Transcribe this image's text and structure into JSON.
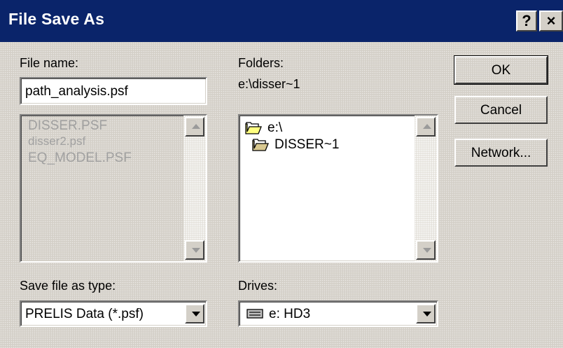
{
  "window": {
    "title": "File Save As",
    "help_label": "?",
    "close_label": "×"
  },
  "file_name": {
    "label": "File name:",
    "value": "path_analysis.psf"
  },
  "file_list": {
    "items": [
      "DISSER.PSF",
      "disser2.psf",
      "EQ_MODEL.PSF"
    ]
  },
  "folders": {
    "label": "Folders:",
    "current_path": "e:\\disser~1",
    "items": [
      "e:\\",
      "DISSER~1"
    ]
  },
  "buttons": {
    "ok": "OK",
    "cancel": "Cancel",
    "network": "Network..."
  },
  "save_type": {
    "label": "Save file as type:",
    "value": "PRELIS Data (*.psf)"
  },
  "drives": {
    "label": "Drives:",
    "value": "e: HD3"
  }
}
